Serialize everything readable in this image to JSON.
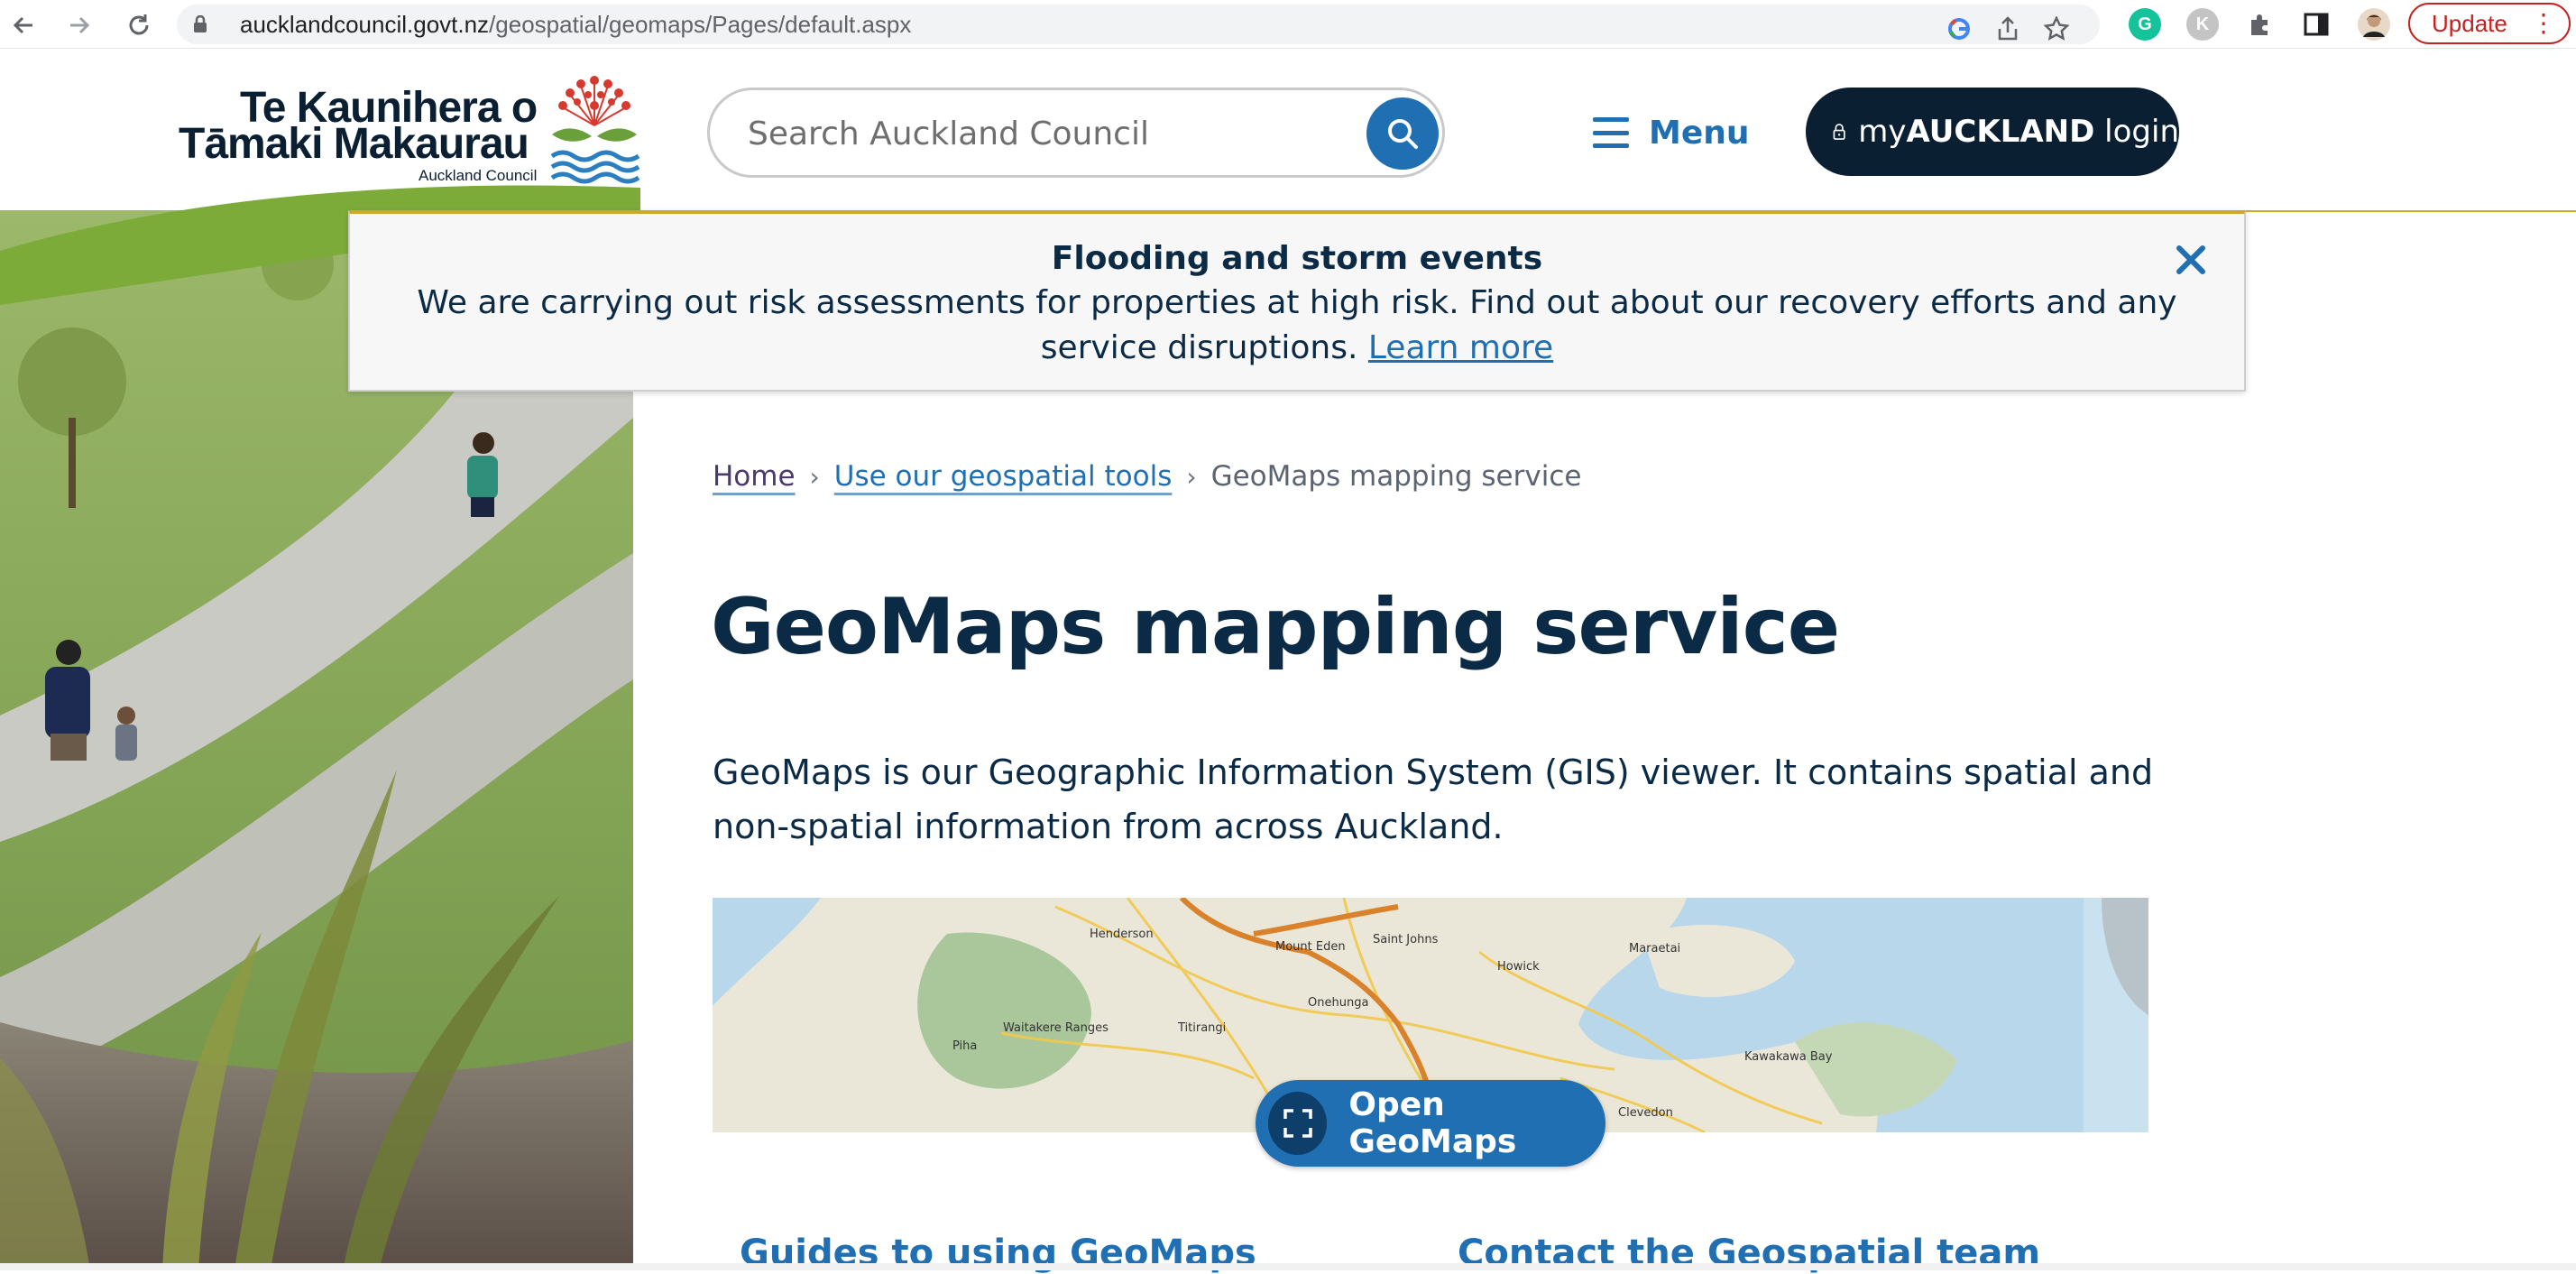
{
  "browser": {
    "url_host": "aucklandcouncil.govt.nz",
    "url_path": "/geospatial/geomaps/Pages/default.aspx",
    "update_label": "Update",
    "extensions": [
      "G",
      "K"
    ],
    "icons": [
      "back-icon",
      "forward-icon",
      "reload-icon",
      "lock-icon",
      "google-icon",
      "share-icon",
      "star-icon",
      "grammarly-icon",
      "extension-k-icon",
      "puzzle-icon",
      "sidebar-icon",
      "profile-avatar",
      "more-icon"
    ]
  },
  "header": {
    "logo_line1": "Te Kaunihera o",
    "logo_line2": "Tāmaki Makaurau",
    "logo_line3": "Auckland Council",
    "search_placeholder": "Search Auckland Council",
    "menu_label": "Menu",
    "login_prefix": "my",
    "login_brand": "AUCKLAND",
    "login_suffix": " login"
  },
  "alert": {
    "title": "Flooding and storm events",
    "body": "We are carrying out risk assessments for properties at high risk. Find out about our recovery efforts and any service disruptions. ",
    "link": "Learn more"
  },
  "breadcrumb": {
    "home": "Home",
    "parent": "Use our geospatial tools",
    "current": "GeoMaps mapping service"
  },
  "main": {
    "title": "GeoMaps mapping service",
    "intro": "GeoMaps is our Geographic Information System (GIS) viewer. It contains spatial and non-spatial information from across Auckland.",
    "open_button": "Open GeoMaps",
    "map_labels": [
      "Henderson",
      "Mount Eden",
      "Saint Johns",
      "Maraetai",
      "Howick",
      "Onehunga",
      "Waitakere Ranges",
      "Piha",
      "Titirangi",
      "Kawakawa Bay",
      "Clevedon"
    ],
    "guides_link": "Guides to using GeoMaps",
    "contact_link": "Contact the Geospatial team"
  },
  "colors": {
    "brand_navy": "#0b1f33",
    "link_blue": "#1f6fb2",
    "alert_accent": "#d0a72c",
    "update_red": "#c5221f"
  }
}
